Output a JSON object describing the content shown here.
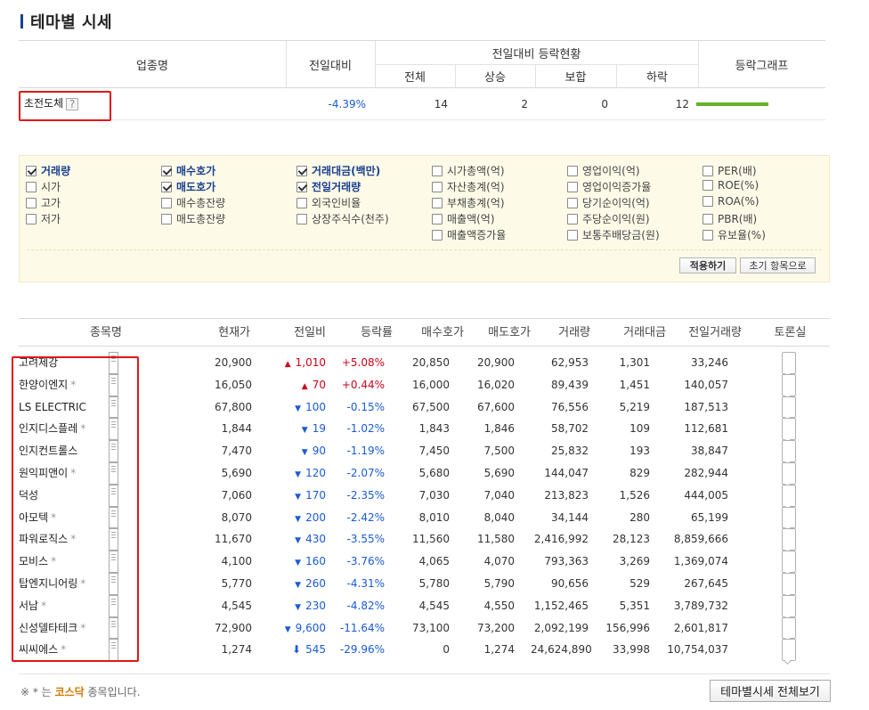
{
  "page_title": "테마별 시세",
  "summary": {
    "headers": {
      "industry": "업종명",
      "change": "전일대비",
      "status_group": "전일대비 등락현황",
      "total": "전체",
      "rise": "상승",
      "flat": "보합",
      "fall": "하락",
      "graph": "등락그래프"
    },
    "row": {
      "name": "초전도체",
      "help": "?",
      "change": "-4.39%",
      "total": "14",
      "rise": "2",
      "flat": "0",
      "fall": "12",
      "rise_ratio": 0.1429,
      "bar_color": "#64b22a"
    }
  },
  "options": {
    "items": [
      {
        "label": "거래량",
        "checked": true
      },
      {
        "label": "시가",
        "checked": false
      },
      {
        "label": "고가",
        "checked": false
      },
      {
        "label": "저가",
        "checked": false
      },
      {
        "label": "매수호가",
        "checked": true
      },
      {
        "label": "매도호가",
        "checked": true
      },
      {
        "label": "매수총잔량",
        "checked": false
      },
      {
        "label": "매도총잔량",
        "checked": false
      },
      {
        "label": "거래대금(백만)",
        "checked": true
      },
      {
        "label": "전일거래량",
        "checked": true
      },
      {
        "label": "외국인비율",
        "checked": false
      },
      {
        "label": "상장주식수(천주)",
        "checked": false
      },
      {
        "label": "시가총액(억)",
        "checked": false
      },
      {
        "label": "자산총계(억)",
        "checked": false
      },
      {
        "label": "부채총계(억)",
        "checked": false
      },
      {
        "label": "매출액(억)",
        "checked": false
      },
      {
        "label": "매출액증가율",
        "checked": false
      },
      {
        "label": "영업이익(억)",
        "checked": false
      },
      {
        "label": "영업이익증가율",
        "checked": false
      },
      {
        "label": "당기순이익(억)",
        "checked": false
      },
      {
        "label": "주당순이익(원)",
        "checked": false
      },
      {
        "label": "보통주배당금(원)",
        "checked": false
      },
      {
        "label": "PER(배)",
        "checked": false
      },
      {
        "label": "ROE(%)",
        "checked": false
      },
      {
        "label": "ROA(%)",
        "checked": false
      },
      {
        "label": "PBR(배)",
        "checked": false
      },
      {
        "label": "유보율(%)",
        "checked": false
      }
    ],
    "apply_label": "적용하기",
    "reset_label": "초기 항목으로"
  },
  "stocks": {
    "headers": [
      "종목명",
      "현재가",
      "전일비",
      "등락률",
      "매수호가",
      "매도호가",
      "거래량",
      "거래대금",
      "전일거래량",
      "토론실"
    ],
    "rows": [
      {
        "name": "고려제강",
        "kosdaq": false,
        "price": "20,900",
        "dir": "up",
        "diff": "1,010",
        "rate": "+5.08%",
        "bid": "20,850",
        "ask": "20,900",
        "vol": "62,953",
        "amt": "1,301",
        "prev_vol": "33,246"
      },
      {
        "name": "한양이엔지",
        "kosdaq": true,
        "price": "16,050",
        "dir": "up",
        "diff": "70",
        "rate": "+0.44%",
        "bid": "16,000",
        "ask": "16,020",
        "vol": "89,439",
        "amt": "1,451",
        "prev_vol": "140,057"
      },
      {
        "name": "LS ELECTRIC",
        "kosdaq": false,
        "price": "67,800",
        "dir": "down",
        "diff": "100",
        "rate": "-0.15%",
        "bid": "67,500",
        "ask": "67,600",
        "vol": "76,556",
        "amt": "5,219",
        "prev_vol": "187,513"
      },
      {
        "name": "인지디스플레",
        "kosdaq": true,
        "price": "1,844",
        "dir": "down",
        "diff": "19",
        "rate": "-1.02%",
        "bid": "1,843",
        "ask": "1,846",
        "vol": "58,702",
        "amt": "109",
        "prev_vol": "112,681"
      },
      {
        "name": "인지컨트롤스",
        "kosdaq": false,
        "price": "7,470",
        "dir": "down",
        "diff": "90",
        "rate": "-1.19%",
        "bid": "7,450",
        "ask": "7,500",
        "vol": "25,832",
        "amt": "193",
        "prev_vol": "38,847"
      },
      {
        "name": "원익피앤이",
        "kosdaq": true,
        "price": "5,690",
        "dir": "down",
        "diff": "120",
        "rate": "-2.07%",
        "bid": "5,680",
        "ask": "5,690",
        "vol": "144,047",
        "amt": "829",
        "prev_vol": "282,944"
      },
      {
        "name": "덕성",
        "kosdaq": false,
        "price": "7,060",
        "dir": "down",
        "diff": "170",
        "rate": "-2.35%",
        "bid": "7,030",
        "ask": "7,040",
        "vol": "213,823",
        "amt": "1,526",
        "prev_vol": "444,005"
      },
      {
        "name": "아모텍",
        "kosdaq": true,
        "price": "8,070",
        "dir": "down",
        "diff": "200",
        "rate": "-2.42%",
        "bid": "8,010",
        "ask": "8,040",
        "vol": "34,144",
        "amt": "280",
        "prev_vol": "65,199"
      },
      {
        "name": "파워로직스",
        "kosdaq": true,
        "price": "11,670",
        "dir": "down",
        "diff": "430",
        "rate": "-3.55%",
        "bid": "11,560",
        "ask": "11,580",
        "vol": "2,416,992",
        "amt": "28,123",
        "prev_vol": "8,859,666"
      },
      {
        "name": "모비스",
        "kosdaq": true,
        "price": "4,100",
        "dir": "down",
        "diff": "160",
        "rate": "-3.76%",
        "bid": "4,065",
        "ask": "4,070",
        "vol": "793,363",
        "amt": "3,269",
        "prev_vol": "1,369,074"
      },
      {
        "name": "탑엔지니어링",
        "kosdaq": true,
        "price": "5,770",
        "dir": "down",
        "diff": "260",
        "rate": "-4.31%",
        "bid": "5,780",
        "ask": "5,790",
        "vol": "90,656",
        "amt": "529",
        "prev_vol": "267,645"
      },
      {
        "name": "서남",
        "kosdaq": true,
        "price": "4,545",
        "dir": "down",
        "diff": "230",
        "rate": "-4.82%",
        "bid": "4,545",
        "ask": "4,550",
        "vol": "1,152,465",
        "amt": "5,351",
        "prev_vol": "3,789,732"
      },
      {
        "name": "신성델타테크",
        "kosdaq": true,
        "price": "72,900",
        "dir": "down",
        "diff": "9,600",
        "rate": "-11.64%",
        "bid": "73,100",
        "ask": "73,200",
        "vol": "2,092,199",
        "amt": "156,996",
        "prev_vol": "2,601,817"
      },
      {
        "name": "씨씨에스",
        "kosdaq": true,
        "price": "1,274",
        "dir": "limit-down",
        "diff": "545",
        "rate": "-29.96%",
        "bid": "0",
        "ask": "1,274",
        "vol": "24,624,890",
        "amt": "33,998",
        "prev_vol": "10,754,037"
      }
    ]
  },
  "footer": {
    "note_pre": "※ * 는",
    "note_kosdaq": "코스닥",
    "note_post": "종목입니다.",
    "all_button": "테마별시세 전체보기"
  },
  "colors": {
    "up": "#d0021b",
    "down": "#1a5bd4",
    "highlight": "#e0171a",
    "title_mark": "#1a3f8f"
  }
}
